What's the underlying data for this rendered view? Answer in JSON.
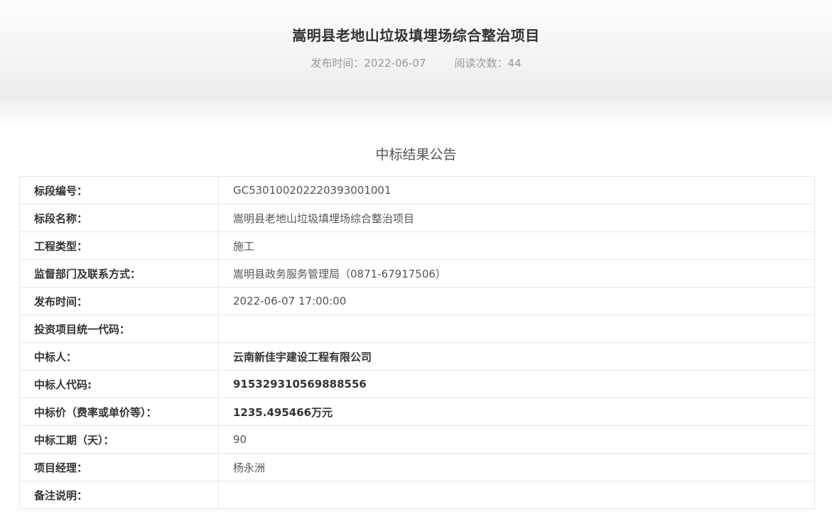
{
  "header": {
    "title": "嵩明县老地山垃圾填埋场综合整治项目",
    "publish_time": "发布时间：2022-06-07",
    "read_count": "阅读次数：44"
  },
  "section_title": "中标结果公告",
  "rows": [
    {
      "label": "标段编号：",
      "value": "GC5301002022203930010​01"
    },
    {
      "label": "标段名称：",
      "value": "嵩明县老地山垃圾填埋场综合整治项目"
    },
    {
      "label": "工程类型：",
      "value": "施工"
    },
    {
      "label": "监督部门及联系方式：",
      "value": "嵩明县政务服务管理局（0871-67917506）"
    },
    {
      "label": "发布时间：",
      "value": "2022-06-07 17:00:00"
    },
    {
      "label": "投资项目统一代码：",
      "value": ""
    },
    {
      "label": "中标人：",
      "value": "云南新佳宇建设工程有限公司"
    },
    {
      "label": "中标人代码:",
      "value": "915329310569888556"
    },
    {
      "label": "中标价（费率或单价等）：",
      "value": "1235.495466万元"
    },
    {
      "label": "中标工期（天）：",
      "value": "90"
    },
    {
      "label": "项目经理：",
      "value": "杨永洲"
    },
    {
      "label": "备注说明：",
      "value": ""
    }
  ]
}
